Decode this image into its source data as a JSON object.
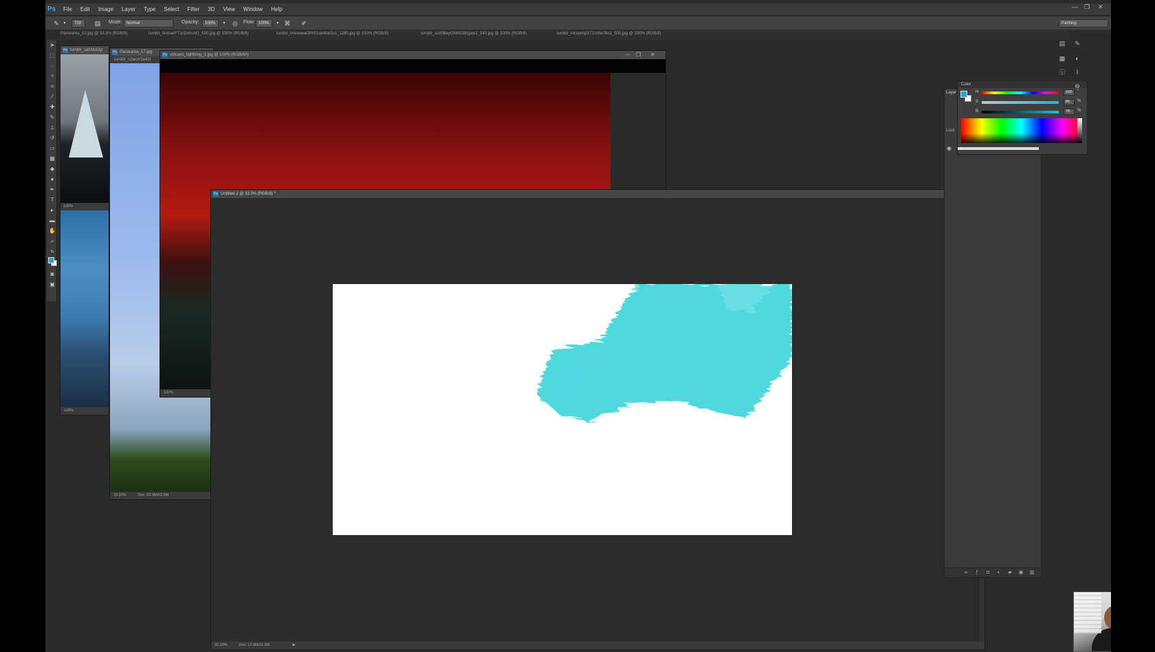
{
  "app": {
    "logo": "Ps",
    "menu": [
      "File",
      "Edit",
      "Image",
      "Layer",
      "Type",
      "Select",
      "Filter",
      "3D",
      "View",
      "Window",
      "Help"
    ],
    "window_controls": [
      "—",
      "❐",
      "✕"
    ]
  },
  "options_bar": {
    "brush_size": "700",
    "mode_label": "Mode:",
    "mode_value": "Normal",
    "opacity_label": "Opacity:",
    "opacity_value": "100%",
    "flow_label": "Flow:",
    "flow_value": "100%",
    "workspace": "Painting"
  },
  "doc_tabs": [
    "Panorama_10.jpg @ 33.3% (RGB/8)",
    "tumblr_finsnarFT1r1bmunt1_500.jpg @ 100% (RGB/8)",
    "tumblr_mxowwaO0h51qb4bb2o1_1280.jpg @ 100% (RGB/8)",
    "tumblr_ssd5BeyGN6lt1bhjyeo1_540.jpg @ 100% (RGB/8)",
    "tumblr_mtxpenjz5T1tz8w78o1_500.jpg @ 100% (RGB/8)"
  ],
  "windows": {
    "iceberg": {
      "title": "tumblr_sab1bzl1p",
      "zoom": "100%"
    },
    "panorama": {
      "title": "Panorama_17.jpg",
      "sub": "tumblr_n2aozr1e41t",
      "zoom": "33.33%",
      "doc": "Doc: 62.9M/62.9M"
    },
    "volcano": {
      "title": "volcano_lightning_2.jpg @ 100% (RGB/8#)",
      "zoom": "100%"
    },
    "untitled": {
      "title": "Untitled-2 @ 33.3% (RGB/8) *",
      "zoom": "33.33%",
      "doc": "Doc: 17.0M/11.2M"
    }
  },
  "color_panel": {
    "title": "Color",
    "channels": [
      {
        "label": "H",
        "value": "182"
      },
      {
        "label": "S",
        "value": "85"
      },
      {
        "label": "B",
        "value": "78"
      }
    ],
    "unit_deg": "°",
    "unit_pct": "%",
    "foreground": "#1ea7d8",
    "background": "#ffffff"
  },
  "layers_panel": {
    "title": "Layer",
    "lock_label": "Lock"
  },
  "brush_color": "#4fd8de"
}
